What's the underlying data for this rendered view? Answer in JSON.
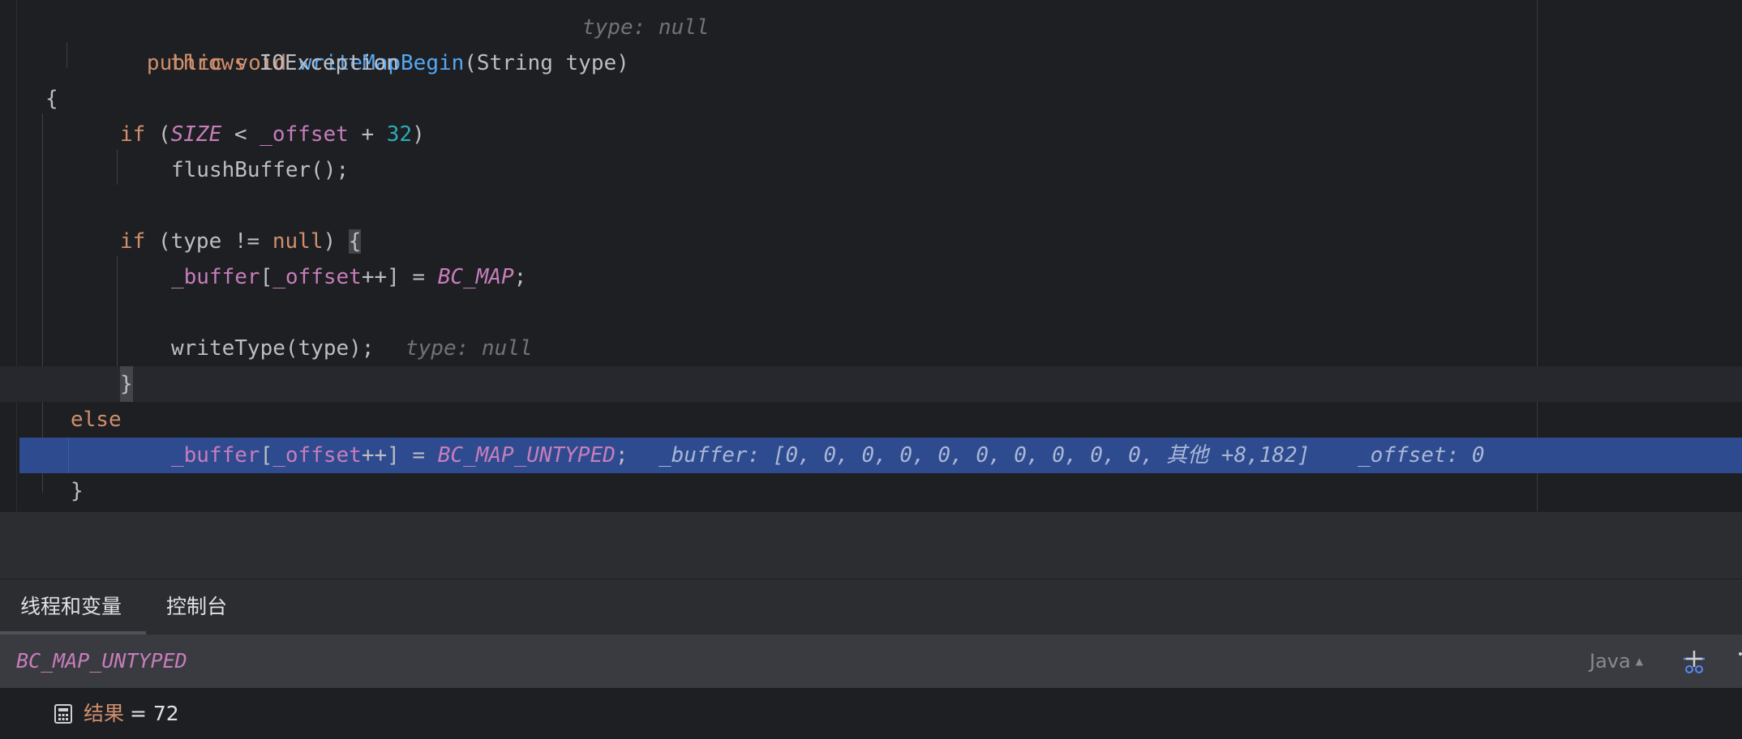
{
  "editor": {
    "l1": {
      "kw1": "public",
      "kw2": "void",
      "fn": "writeMapBegin",
      "rest": "(String type)",
      "hint": "type: null"
    },
    "l2": {
      "kw": "throws",
      "rest": "IOException"
    },
    "l3": {
      "text": "{"
    },
    "l4": {
      "kw": "if",
      "open": "(",
      "cst": "SIZE",
      "mid": " < ",
      "fld": "_offset",
      "plus": " + ",
      "num": "32",
      "close": ")"
    },
    "l5": {
      "text": "flushBuffer();"
    },
    "l7": {
      "kw": "if",
      "open": " (type != ",
      "kw2": "null",
      "close": ") ",
      "brace": "{"
    },
    "l8": {
      "fld1": "_buffer",
      "b1": "[",
      "fld2": "_offset",
      "b2": "++] = ",
      "cst": "BC_MAP",
      "semi": ";"
    },
    "l10": {
      "text": "writeType(type);",
      "hint": "type: null"
    },
    "l11": {
      "brace": "}"
    },
    "l12": {
      "kw": "else"
    },
    "l13": {
      "fld1": "_buffer",
      "b1": "[",
      "fld2": "_offset",
      "b2": "++] = ",
      "cst": "BC_MAP_UNTYPED",
      "semi": ";",
      "hint1": "_buffer: [0, 0, 0, 0, 0, 0, 0, 0, 0, 0, 其他 +8,182]",
      "hint2": "_offset: 0"
    },
    "l14": {
      "text": "}"
    }
  },
  "tabs": {
    "threads_vars": "线程和变量",
    "console": "控制台"
  },
  "evaluate": {
    "expression": "BC_MAP_UNTYPED",
    "language": "Java"
  },
  "result": {
    "name": "结果",
    "value": "= 72"
  },
  "icons": {
    "eval": "add-watch-icon",
    "result": "calculator-icon",
    "more": "more-icon"
  }
}
